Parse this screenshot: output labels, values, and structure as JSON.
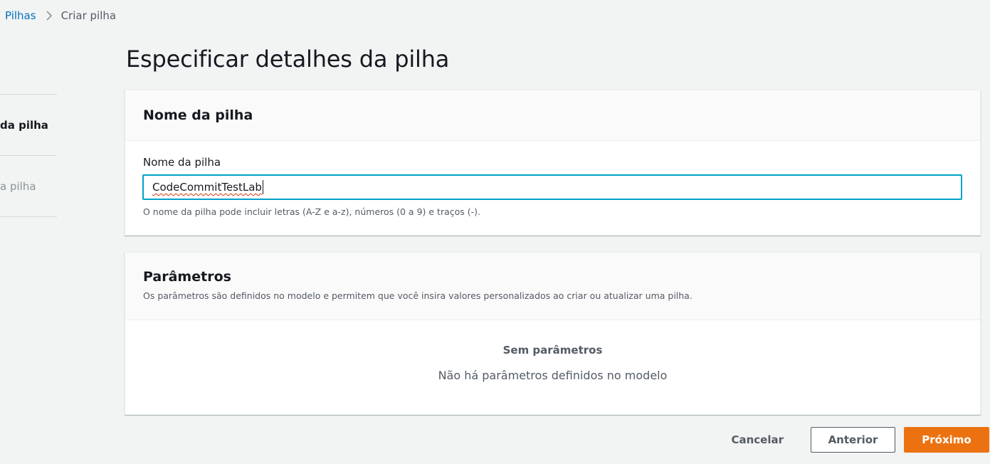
{
  "breadcrumb": {
    "parent": "Pilhas",
    "current": "Criar pilha"
  },
  "steps": [
    {
      "label": "da pilha",
      "state": "active"
    },
    {
      "label": "a pilha",
      "state": "inactive"
    }
  ],
  "page": {
    "title": "Especificar detalhes da pilha"
  },
  "stack_name_panel": {
    "title": "Nome da pilha",
    "field_label": "Nome da pilha",
    "field_value": "CodeCommitTestLab",
    "field_hint": "O nome da pilha pode incluir letras (A-Z e a-z), números (0 a 9) e traços (-)."
  },
  "parameters_panel": {
    "title": "Parâmetros",
    "description": "Os parâmetros são definidos no modelo e permitem que você insira valores personalizados ao criar ou atualizar uma pilha.",
    "empty_title": "Sem parâmetros",
    "empty_description": "Não há parâmetros definidos no modelo"
  },
  "actions": {
    "cancel": "Cancelar",
    "previous": "Anterior",
    "next": "Próximo"
  },
  "colors": {
    "link": "#0073bb",
    "focus_border": "#00a1c9",
    "primary_button": "#ec7211",
    "background": "#f2f3f3"
  }
}
